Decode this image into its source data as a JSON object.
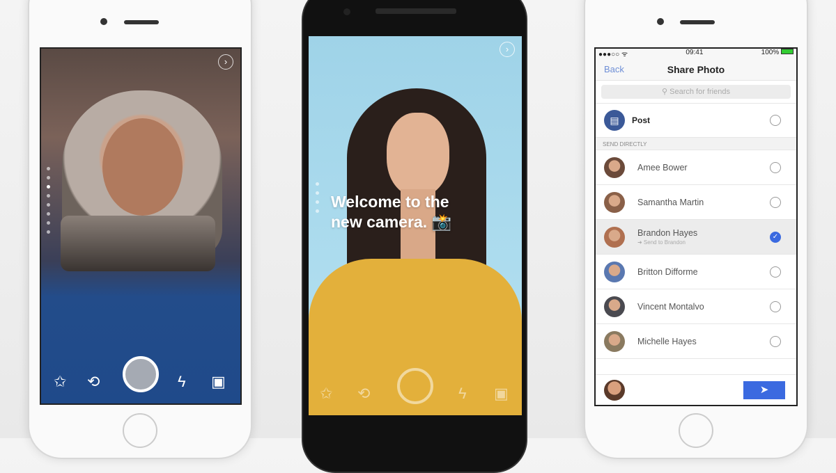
{
  "left_phone": {
    "screen": "camera-with-mask-effect",
    "controls": [
      "effects-icon",
      "flip-camera-icon",
      "shutter-button",
      "flash-off-icon",
      "gallery-icon"
    ]
  },
  "middle_phone": {
    "welcome_line1": "Welcome to the",
    "welcome_line2": "new camera. 📸"
  },
  "right_phone": {
    "status": {
      "signal": "●●●○○ ᯤ",
      "time": "09:41",
      "battery": "100%"
    },
    "nav": {
      "back": "Back",
      "title": "Share Photo"
    },
    "search_placeholder": "Search for friends",
    "post_label": "Post",
    "section_label": "SEND DIRECTLY",
    "friends": [
      {
        "name": "Amee Bower",
        "selected": false
      },
      {
        "name": "Samantha Martin",
        "selected": false
      },
      {
        "name": "Brandon Hayes",
        "selected": true,
        "sub": "➜ Send to Brandon"
      },
      {
        "name": "Britton Difforme",
        "selected": false
      },
      {
        "name": "Vincent Montalvo",
        "selected": false
      },
      {
        "name": "Michelle Hayes",
        "selected": false
      }
    ]
  },
  "colors": {
    "accent": "#3b6ae0",
    "post_icon": "#3b5998",
    "sky": "#a8d8ec",
    "shirt": "#e6b43a"
  }
}
